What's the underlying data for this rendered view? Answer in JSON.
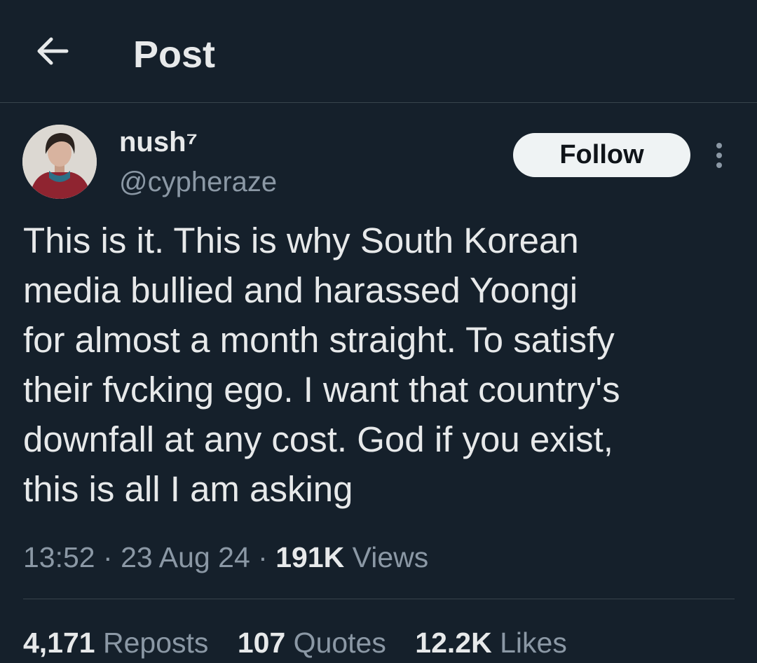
{
  "header": {
    "back_icon": "arrow-left-icon",
    "title": "Post"
  },
  "author": {
    "avatar_icon": "avatar-photo",
    "name": "nush⁷",
    "handle": "@cypheraze",
    "follow_label": "Follow",
    "more_icon": "vertical-ellipsis-icon"
  },
  "post": {
    "lines": [
      "This is it. This is why South Korean",
      "media bullied and harassed Yoongi",
      "for almost a month straight. To satisfy",
      "their fvcking ego. I want that country's",
      "downfall at any cost. God if you exist,",
      "this is all I am asking"
    ]
  },
  "meta": {
    "time": "13:52",
    "separator": "·",
    "date": "23 Aug 24",
    "views_count": "191K",
    "views_label": "Views"
  },
  "stats": {
    "reposts_count": "4,171",
    "reposts_label": "Reposts",
    "quotes_count": "107",
    "quotes_label": "Quotes",
    "likes_count": "12.2K",
    "likes_label": "Likes"
  },
  "colors": {
    "background": "#15202b",
    "text_primary": "#e7e9ea",
    "text_secondary": "#8b98a5",
    "border": "#38444d",
    "follow_button_bg": "#eff3f4"
  }
}
